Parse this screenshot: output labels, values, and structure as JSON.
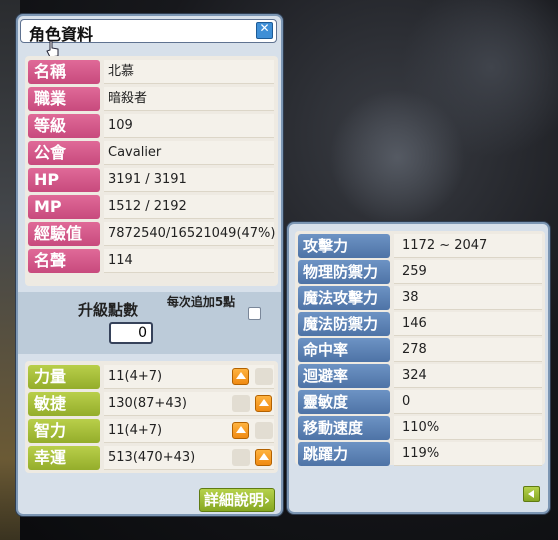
{
  "window": {
    "title": "角色資料"
  },
  "info": [
    {
      "label": "名稱",
      "value": "北慕"
    },
    {
      "label": "職業",
      "value": "暗殺者"
    },
    {
      "label": "等級",
      "value": "109"
    },
    {
      "label": "公會",
      "value": "Cavalier"
    },
    {
      "label": "HP",
      "value": "3191 / 3191"
    },
    {
      "label": "MP",
      "value": "1512 / 2192"
    },
    {
      "label": "經驗值",
      "value": "7872540/16521049(47%)"
    },
    {
      "label": "名聲",
      "value": "114"
    }
  ],
  "level_up": {
    "label": "升級點數",
    "value": "0",
    "bulk_label": "每次追加5點",
    "bulk_checked": false
  },
  "stats": [
    {
      "label": "力量",
      "value": "11(4+7)"
    },
    {
      "label": "敏捷",
      "value": "130(87+43)"
    },
    {
      "label": "智力",
      "value": "11(4+7)"
    },
    {
      "label": "幸運",
      "value": "513(470+43)"
    }
  ],
  "detail_button": "詳細說明›",
  "detail_stats": [
    {
      "label": "攻擊力",
      "value": "1172 ~ 2047"
    },
    {
      "label": "物理防禦力",
      "value": "259"
    },
    {
      "label": "魔法攻擊力",
      "value": "38"
    },
    {
      "label": "魔法防禦力",
      "value": "146"
    },
    {
      "label": "命中率",
      "value": "278"
    },
    {
      "label": "迴避率",
      "value": "324"
    },
    {
      "label": "靈敏度",
      "value": "0"
    },
    {
      "label": "移動速度",
      "value": "110%"
    },
    {
      "label": "跳躍力",
      "value": "119%"
    }
  ],
  "colors": {
    "label_pink": "#c84a7d",
    "label_green": "#94ad2b",
    "label_blue": "#4e73a6",
    "up_button": "#f08a12"
  }
}
